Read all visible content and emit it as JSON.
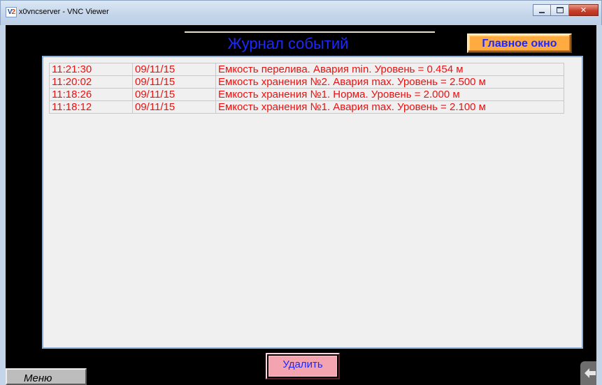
{
  "window": {
    "title": "x0vncserver - VNC Viewer",
    "icon": "vnc-viewer-icon",
    "controls": [
      "minimize-icon",
      "maximize-icon",
      "close-icon"
    ]
  },
  "header": {
    "title": "Журнал событий",
    "main_window_button": "Главное окно"
  },
  "log": {
    "rows": [
      {
        "time": "11:21:30",
        "date": "09/11/15",
        "message": "Емкость перелива. Авария min. Уровень = 0.454 м"
      },
      {
        "time": "11:20:02",
        "date": "09/11/15",
        "message": "Емкость хранения №2. Авария max. Уровень = 2.500 м"
      },
      {
        "time": "11:18:26",
        "date": "09/11/15",
        "message": "Емкость хранения №1. Норма. Уровень = 2.000 м"
      },
      {
        "time": "11:18:12",
        "date": "09/11/15",
        "message": "Емкость хранения №1. Авария max. Уровень = 2.100 м"
      }
    ]
  },
  "footer": {
    "delete_button": "Удалить",
    "menu_button": "Меню",
    "back_icon": "arrow-left-icon"
  },
  "colors": {
    "title_blue": "#1c28ff",
    "log_text_red": "#ee1010",
    "main_button_orange": "#ffab40",
    "delete_button_pink": "#f3a4b0"
  }
}
